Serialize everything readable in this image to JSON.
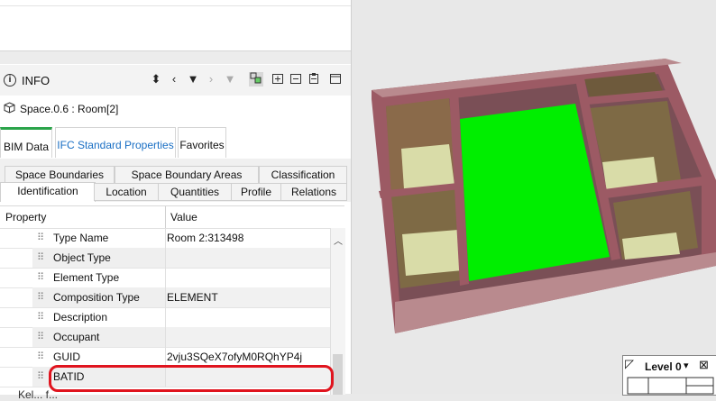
{
  "panel": {
    "title": "INFO",
    "object_label": "Space.0.6 : Room[2]"
  },
  "icons": {
    "info": "info-icon",
    "updown": "updown-arrows-icon",
    "prev": "chevron-left-icon",
    "dropdown": "triangle-down-icon",
    "next": "chevron-right-icon",
    "dropdown2": "triangle-down-icon",
    "filter": "model-filter-icon",
    "add": "add-icon",
    "remove": "remove-icon",
    "clip": "clipboard-icon",
    "window": "window-icon",
    "cube": "cube-icon"
  },
  "tabs": [
    "BIM Data",
    "IFC Standard Properties",
    "Favorites"
  ],
  "subtabs": {
    "row1": [
      "Space Boundaries",
      "Space Boundary Areas",
      "Classification"
    ],
    "row2": [
      "Identification",
      "Location",
      "Quantities",
      "Profile",
      "Relations"
    ]
  },
  "grid": {
    "headers": [
      "Property",
      "Value"
    ],
    "rows": [
      {
        "name": "Type Name",
        "value": "Room 2:313498"
      },
      {
        "name": "Object Type",
        "value": ""
      },
      {
        "name": "Element Type",
        "value": ""
      },
      {
        "name": "Composition Type",
        "value": "ELEMENT"
      },
      {
        "name": "Description",
        "value": ""
      },
      {
        "name": "Occupant",
        "value": ""
      },
      {
        "name": "GUID",
        "value": "2vju3SQeX7ofyM0RQhYP4j"
      },
      {
        "name": "BATID",
        "value": ""
      }
    ],
    "cutoff_text": "Kel... f..."
  },
  "viewport": {
    "level_label": "Level 0",
    "highlight_color": "#00ee00",
    "wall_color": "#9c5a64",
    "floor_color": "#d9dca8"
  }
}
